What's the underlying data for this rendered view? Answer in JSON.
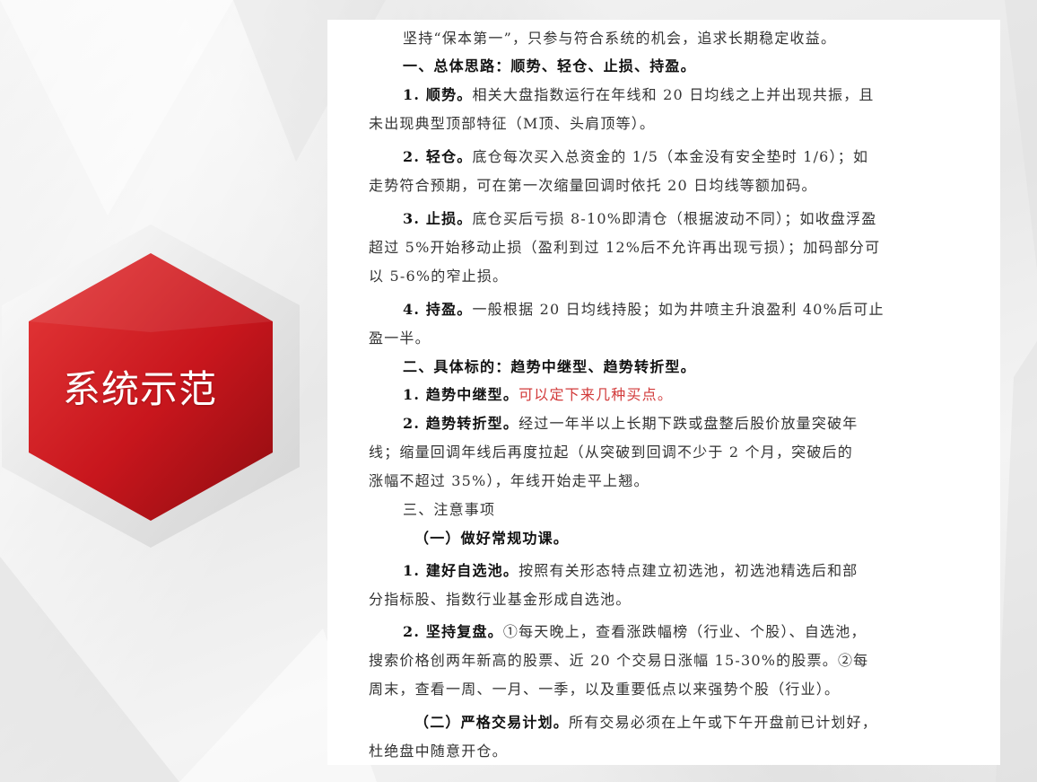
{
  "slide": {
    "title": "系统示范",
    "colors": {
      "hexagon_red": "#c8161d",
      "highlight_red": "#d23a3a",
      "text": "#333333"
    }
  },
  "document": {
    "lines": [
      {
        "pre": "坚持“保本第一”，只参与符合系统的机会，追求长期稳定收益。"
      },
      {
        "bold": "一、总体思路：顺势、轻仓、止损、持盈。"
      },
      {
        "bold": "1. 顺势。",
        "rest": "相关大盘指数运行在年线和 20 日均线之上并出现共振，且"
      },
      {
        "rest": "未出现典型顶部特征（M顶、头肩顶等）。"
      },
      {
        "bold": "2. 轻仓。",
        "rest": "底仓每次买入总资金的 1/5（本金没有安全垫时 1/6）；如"
      },
      {
        "rest": "走势符合预期，可在第一次缩量回调时依托 20 日均线等额加码。"
      },
      {
        "bold": "3. 止损。",
        "rest": "底仓买后亏损 8-10%即清仓（根据波动不同）；如收盘浮盈"
      },
      {
        "rest": "超过 5%开始移动止损（盈利到过 12%后不允许再出现亏损）；加码部分可"
      },
      {
        "rest": "以 5-6%的窄止损。"
      },
      {
        "bold": "4. 持盈。",
        "rest": "一般根据 20 日均线持股；如为井喷主升浪盈利 40%后可止"
      },
      {
        "rest": "盈一半。"
      },
      {
        "bold": "二、具体标的：趋势中继型、趋势转折型。"
      },
      {
        "bold": "1. 趋势中继型。",
        "red": "可以定下来几种买点。"
      },
      {
        "bold": "2. 趋势转折型。",
        "rest": "经过一年半以上长期下跌或盘整后股价放量突破年"
      },
      {
        "rest": "线；缩量回调年线后再度拉起（从突破到回调不少于 2 个月，突破后的"
      },
      {
        "rest": "涨幅不超过 35%），年线开始走平上翘。"
      },
      {
        "pre": "三、注意事项"
      },
      {
        "bold": "（一）做好常规功课。"
      },
      {
        "bold": "1. 建好自选池。",
        "rest": "按照有关形态特点建立初选池，初选池精选后和部"
      },
      {
        "rest": "分指标股、指数行业基金形成自选池。"
      },
      {
        "bold": "2. 坚持复盘。",
        "rest": "①每天晚上，查看涨跌幅榜（行业、个股）、自选池，"
      },
      {
        "rest": "搜索价格创两年新高的股票、近 20 个交易日涨幅 15-30%的股票。②每"
      },
      {
        "rest": "周末，查看一周、一月、一季，以及重要低点以来强势个股（行业）。"
      },
      {
        "bold": "（二）严格交易计划。",
        "rest": "所有交易必须在上午或下午开盘前已计划好，"
      },
      {
        "rest": "杜绝盘中随意开仓。"
      }
    ]
  }
}
